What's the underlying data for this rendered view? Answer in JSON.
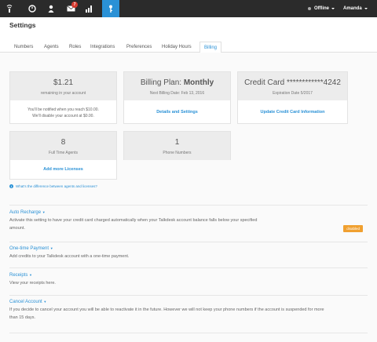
{
  "topbar": {
    "badge_count": "7",
    "status_label": "Offline",
    "user_label": "Amanda"
  },
  "page": {
    "title": "Settings"
  },
  "tabs": [
    {
      "label": "Numbers"
    },
    {
      "label": "Agents"
    },
    {
      "label": "Roles"
    },
    {
      "label": "Integrations"
    },
    {
      "label": "Preferences"
    },
    {
      "label": "Holiday Hours"
    },
    {
      "label": "Billing"
    }
  ],
  "cards": {
    "balance": {
      "amount": "$1.21",
      "sub": "remaining in your account",
      "line1": "You'll be notified when you reach $10.00.",
      "line2": "We'll disable your account at $0.00."
    },
    "plan": {
      "prefix": "Billing Plan: ",
      "name": "Monthly",
      "sub": "Next Billing Date: Feb 13, 2016",
      "link": "Details and Settings"
    },
    "credit": {
      "title": "Credit Card ************4242",
      "sub": "Expiration Date 5/2017",
      "link": "Update Credit Card Information"
    },
    "agents": {
      "count": "8",
      "label": "Full Time Agents",
      "link": "Add more Licenses"
    },
    "phones": {
      "count": "1",
      "label": "Phone Numbers"
    }
  },
  "info_link": "What's the difference between agents and licenses?",
  "sections": {
    "auto_recharge": {
      "title": "Auto Recharge",
      "text1": "Activate this setting to have your credit card charged automatically when your Talkdesk account balance falls below your specified",
      "text2": "amount.",
      "tag": "disabled"
    },
    "one_time": {
      "title": "One-time Payment",
      "text": "Add credits to your Talkdesk account with a one-time payment."
    },
    "receipts": {
      "title": "Receipts",
      "text": "View your receipts here."
    },
    "cancel": {
      "title": "Cancel Account",
      "text1": "If you decide to cancel your account you will be able to reactivate it in the future. However we will not keep your phone numbers if the account is suspended for more",
      "text2": "than 15 days."
    }
  },
  "colors": {
    "topbar": "#2b2b2b",
    "accent": "#2a91d6",
    "badge": "#d63a2f",
    "disabled_tag": "#f0a030"
  },
  "icons": [
    "talkdesk-logo-icon",
    "dashboard-icon",
    "contacts-icon",
    "inbox-icon",
    "reports-icon",
    "admin-key-icon"
  ]
}
